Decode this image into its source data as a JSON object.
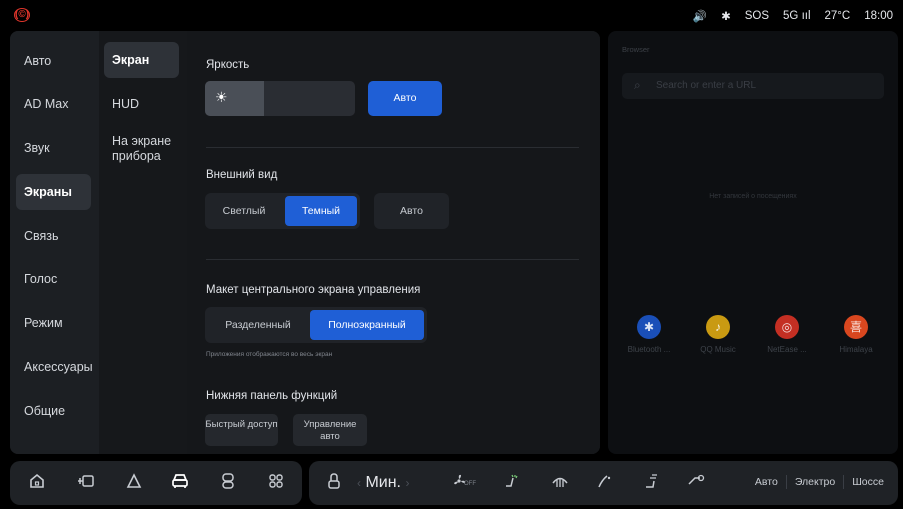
{
  "statusbar": {
    "left_icon": "(©)",
    "items": [
      "🔊",
      "✱",
      "SOS",
      "5G ııl",
      "27°C",
      "18:00"
    ]
  },
  "nav_primary": [
    {
      "label": "Авто",
      "active": false
    },
    {
      "label": "AD Max",
      "active": false
    },
    {
      "label": "Звук",
      "active": false
    },
    {
      "label": "Экраны",
      "active": true
    },
    {
      "label": "Связь",
      "active": false
    },
    {
      "label": "Голос",
      "active": false
    },
    {
      "label": "Режим",
      "active": false
    },
    {
      "label": "Аксессуары",
      "active": false
    },
    {
      "label": "Общие",
      "active": false
    }
  ],
  "nav_secondary": [
    {
      "label": "Экран",
      "active": true
    },
    {
      "label": "HUD",
      "active": false
    },
    {
      "label": "На экране прибора",
      "active": false
    }
  ],
  "brightness": {
    "title": "Яркость",
    "level_percent": 39,
    "auto_label": "Авто",
    "sun_icon": "sun-icon"
  },
  "appearance": {
    "title": "Внешний вид",
    "options": [
      "Светлый",
      "Темный"
    ],
    "selected": "Темный",
    "auto_label": "Авто"
  },
  "layout": {
    "title": "Макет центрального экрана управления",
    "options": [
      "Разделенный",
      "Полноэкранный"
    ],
    "selected": "Полноэкранный",
    "hint": "Приложения отображаются во весь экран"
  },
  "bottom_panel": {
    "title": "Нижняя панель функций",
    "chips": [
      "Быстрый доступ",
      "Управление авто"
    ]
  },
  "browser": {
    "label": "Browser",
    "search_placeholder": "Search or enter a URL",
    "empty_text": "Нет записей о посещениях",
    "apps": [
      {
        "name": "Bluetooth ...",
        "color": "#1a4fb8",
        "icon": "✱"
      },
      {
        "name": "QQ Music",
        "color": "#c99a12",
        "icon": "♪"
      },
      {
        "name": "NetEase ...",
        "color": "#c42f23",
        "icon": "◎"
      },
      {
        "name": "Himalaya",
        "color": "#d9471f",
        "icon": "喜"
      }
    ]
  },
  "dock": {
    "temperature": "Мин.",
    "fan_label": "OFF",
    "modes": [
      "Авто",
      "Электро",
      "Шоссе"
    ]
  },
  "colors": {
    "accent": "#1f5fd6",
    "background": "#15171a"
  }
}
